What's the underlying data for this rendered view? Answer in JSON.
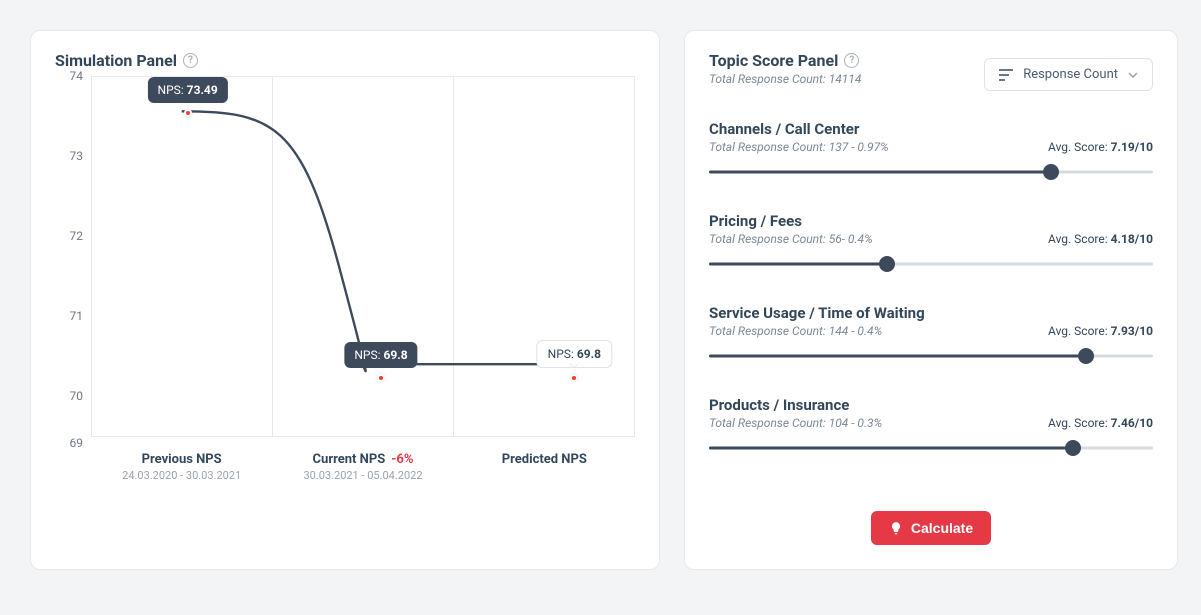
{
  "sim": {
    "title": "Simulation Panel",
    "yticks": [
      69,
      70,
      71,
      72,
      73,
      74
    ],
    "x": [
      {
        "label": "Previous NPS",
        "dates": "24.03.2020 - 30.03.2021",
        "delta": ""
      },
      {
        "label": "Current NPS",
        "dates": "30.03.2021 - 05.04.2022",
        "delta": "-6%"
      },
      {
        "label": "Predicted NPS",
        "dates": "",
        "delta": ""
      }
    ],
    "tooltips": {
      "prefix": "NPS: ",
      "prev": "73.49",
      "curr": "69.8",
      "pred": "69.8"
    }
  },
  "topics": {
    "title": "Topic Score Panel",
    "subheader": "Total Response Count: 14114",
    "dropdown": "Response Count",
    "avg_label": "Avg. Score: ",
    "resp_prefix": "Total Response Count: ",
    "items": [
      {
        "name": "Channels / Call Center",
        "resp": "137 - 0.97%",
        "score": "7.19/10",
        "pos": 77
      },
      {
        "name": "Pricing / Fees",
        "resp": "56- 0.4%",
        "score": "4.18/10",
        "pos": 40
      },
      {
        "name": "Service Usage / Time of Waiting",
        "resp": "144 - 0.4%",
        "score": "7.93/10",
        "pos": 85
      },
      {
        "name": "Products / Insurance",
        "resp": "104 - 0.3%",
        "score": "7.46/10",
        "pos": 82
      }
    ],
    "button": "Calculate"
  },
  "chart_data": {
    "type": "line",
    "title": "Simulation Panel",
    "ylabel": "NPS",
    "xlabel": "",
    "ylim": [
      69,
      74
    ],
    "categories": [
      "Previous NPS",
      "Current NPS",
      "Predicted NPS"
    ],
    "values": [
      73.49,
      69.8,
      69.8
    ],
    "annotations": [
      {
        "category": "Previous NPS",
        "date_range": "24.03.2020 - 30.03.2021"
      },
      {
        "category": "Current NPS",
        "date_range": "30.03.2021 - 05.04.2022",
        "delta": "-6%"
      }
    ]
  }
}
